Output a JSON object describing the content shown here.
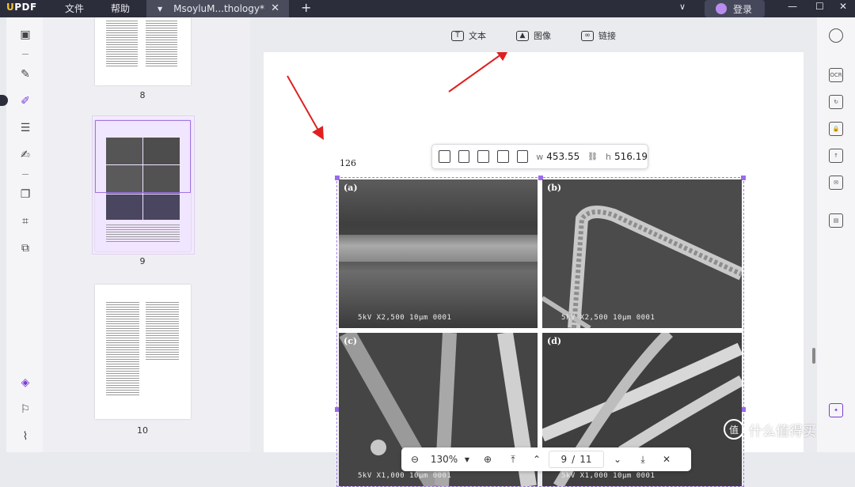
{
  "app": {
    "logo": "UPDF",
    "menu": [
      "文件",
      "帮助"
    ],
    "tab_title": "MsoyluM...thology*",
    "login_label": "登录"
  },
  "top_tools": [
    {
      "label": "文本",
      "icon": "text-tool-icon"
    },
    {
      "label": "图像",
      "icon": "image-tool-icon"
    },
    {
      "label": "链接",
      "icon": "link-tool-icon"
    }
  ],
  "thumbnails": [
    {
      "page": "8"
    },
    {
      "page": "9"
    },
    {
      "page": "10"
    }
  ],
  "document": {
    "page_header_number": "126",
    "panels": [
      {
        "label": "(a)",
        "info": "5kV  X2,500  10μm 0001"
      },
      {
        "label": "(b)",
        "info": "5kV  X2,500  10μm 0001"
      },
      {
        "label": "(c)",
        "info": "5kV  X1,000  10μm 0001"
      },
      {
        "label": "(d)",
        "info": "5kV  X1,000  10μm 0001"
      }
    ]
  },
  "image_toolbar": {
    "width_label": "w",
    "width_value": "453.55",
    "height_label": "h",
    "height_value": "516.19"
  },
  "navigator": {
    "zoom": "130%",
    "page_current": "9",
    "page_sep": "/",
    "page_total": "11"
  },
  "watermark": "什么值得买",
  "colors": {
    "accent": "#7a3bd6",
    "annotation_arrow": "#e02020",
    "titlebar": "#2b2d3a"
  }
}
